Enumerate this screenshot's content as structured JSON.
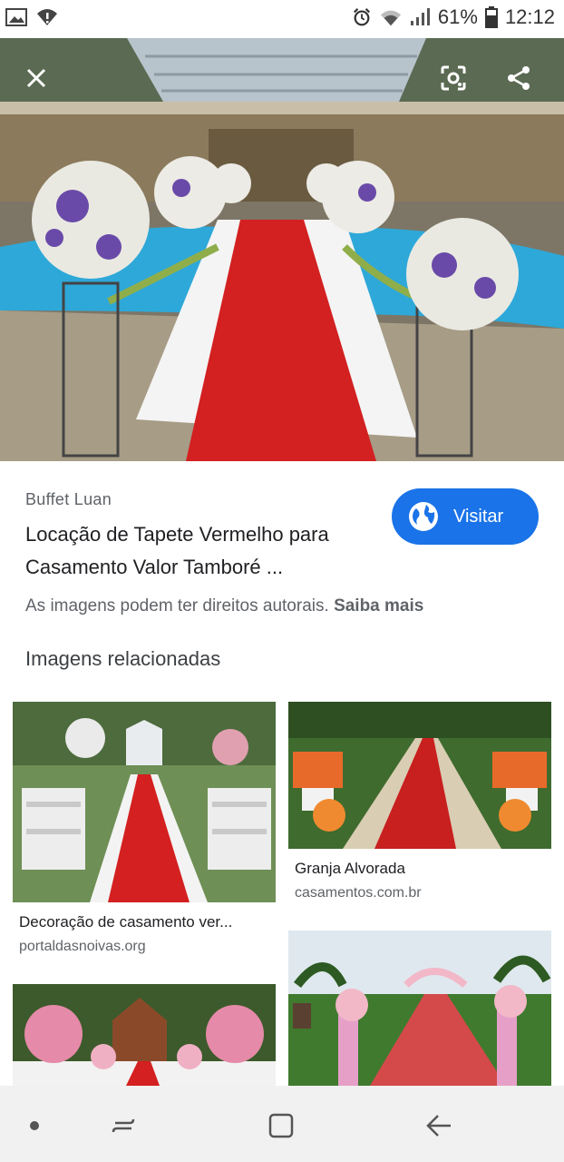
{
  "status_bar": {
    "battery": "61%",
    "time": "12:12",
    "icons": [
      "image-icon",
      "wifi-alert-icon",
      "alarm-icon",
      "wifi-icon",
      "signal-icon",
      "battery-icon"
    ]
  },
  "viewer": {
    "close_icon": "close-icon",
    "lens_icon": "lens-icon",
    "share_icon": "share-icon"
  },
  "result": {
    "source": "Buffet Luan",
    "title": "Locação de Tapete Vermelho para Casamento Valor Tamboré ...",
    "visit_label": "Visitar",
    "copyright_text": "As imagens podem ter direitos autorais.",
    "learn_more": "Saiba mais"
  },
  "related": {
    "heading": "Imagens relacionadas",
    "items": [
      {
        "title": "Decoração de casamento ver...",
        "site": "portaldasnoivas.org"
      },
      {
        "title": "Granja Alvorada",
        "site": "casamentos.com.br"
      },
      {
        "title": "",
        "site": ""
      },
      {
        "title": "",
        "site": ""
      }
    ]
  },
  "nav_bar": {
    "icons": [
      "home-dot-icon",
      "recents-icon",
      "overview-icon",
      "back-icon"
    ]
  },
  "colors": {
    "accent": "#1a73e8",
    "carpet": "#d32020"
  }
}
